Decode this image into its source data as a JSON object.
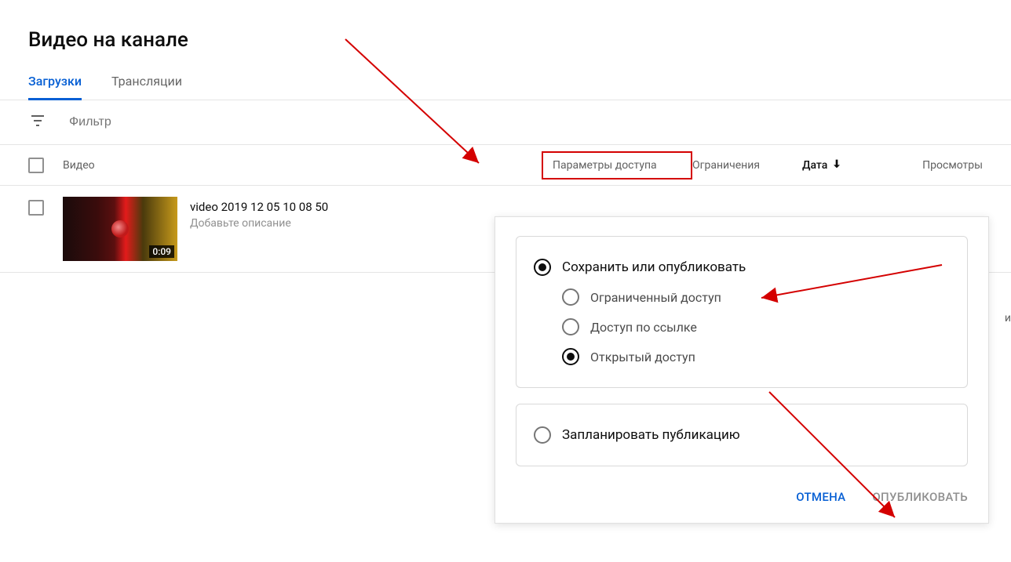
{
  "page_title": "Видео на канале",
  "tabs": {
    "uploads": "Загрузки",
    "live": "Трансляции"
  },
  "filter": {
    "placeholder": "Фильтр"
  },
  "columns": {
    "video": "Видео",
    "visibility": "Параметры доступа",
    "restrictions": "Ограничения",
    "date": "Дата",
    "views": "Просмотры"
  },
  "videos": [
    {
      "title": "video 2019 12 05 10 08 50",
      "description_placeholder": "Добавьте описание",
      "duration": "0:09"
    }
  ],
  "cut_text": "и",
  "popup": {
    "save_or_publish": "Сохранить или опубликовать",
    "private": "Ограниченный доступ",
    "unlisted": "Доступ по ссылке",
    "public": "Открытый доступ",
    "schedule": "Запланировать публикацию",
    "cancel": "ОТМЕНА",
    "publish": "ОПУБЛИКОВАТЬ"
  },
  "annotation_color": "#d40000"
}
